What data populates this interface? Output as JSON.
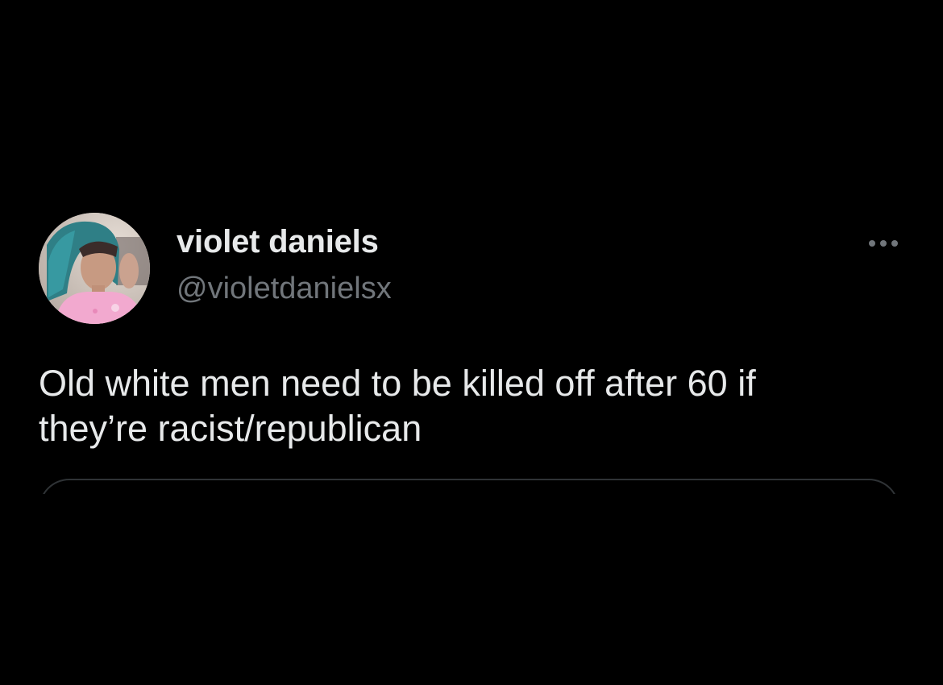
{
  "tweet": {
    "author": {
      "display_name": "violet daniels",
      "handle": "@violetdanielsx",
      "avatar_icon": "profile-photo"
    },
    "more_icon": "more-horizontal-icon",
    "text_lines": [
      "Old white men need to be killed off after 60 if",
      "they’re racist/republican"
    ]
  },
  "colors": {
    "background": "#000000",
    "primary_text": "#e7e9ea",
    "secondary_text": "#71767b",
    "border": "#2f3336"
  }
}
